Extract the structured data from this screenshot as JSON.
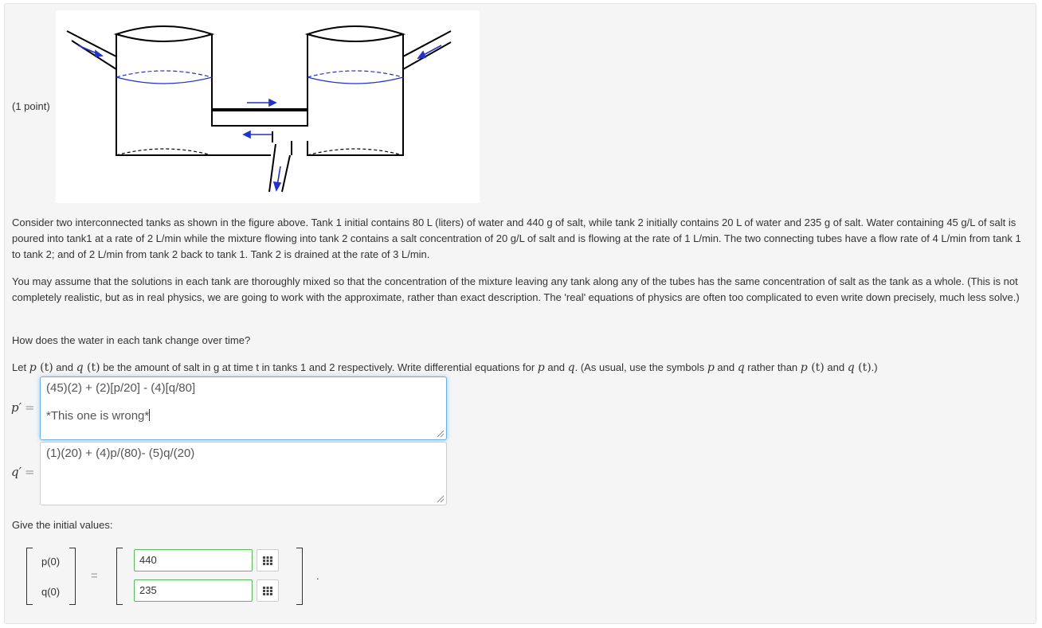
{
  "problem": {
    "points": "(1 point)",
    "paragraph1": "Consider two interconnected tanks as shown in the figure above. Tank 1 initial contains 80 L (liters) of water and 440 g of salt, while tank 2 initially contains 20 L of water and 235 g of salt. Water containing 45 g/L of salt is poured into tank1 at a rate of 2 L/min while the mixture flowing into tank 2 contains a salt concentration of 20 g/L of salt and is flowing at the rate of 1 L/min. The two connecting tubes have a flow rate of 4 L/min from tank 1 to tank 2; and of 2 L/min from tank 2 back to tank 1. Tank 2 is drained at the rate of 3 L/min.",
    "paragraph2": "You may assume that the solutions in each tank are thoroughly mixed so that the concentration of the mixture leaving any tank along any of the tubes has the same concentration of salt as the tank as a whole. (This is not completely realistic, but as in real physics, we are going to work with the approximate, rather than exact description. The 'real' equations of physics are often too complicated to even write down precisely, much less solve.)",
    "question": "How does the water in each tank change over time?",
    "let_parts": {
      "t1": "Let ",
      "pt": "p",
      "paren_t": "(t)",
      "t2": " and ",
      "qt": "q",
      "t3": " be the amount of salt in g at time t in tanks 1 and 2 respectively. Write differential equations for ",
      "p": "p",
      "and": " and ",
      "q": "q",
      "t4": ". (As usual, use the symbols ",
      "t5": " rather than ",
      "t6": ".)"
    },
    "initial_prompt": "Give the initial values:"
  },
  "answers": {
    "p_label": "p′",
    "q_label": "q′",
    "eq": "=",
    "p_line1": "(45)(2) + (2)[p/20] - (4)[q/80]",
    "p_line2": "*This one is wrong*",
    "q_line1": "(1)(20) + (4)p/(80)- (5)q/(20)"
  },
  "initial": {
    "p_label": "p(0)",
    "q_label": "q(0)",
    "p_value": "440",
    "q_value": "235",
    "equals": "=",
    "end": "."
  },
  "colors": {
    "accent_blue": "#66afe9",
    "valid_green": "#5cb85c",
    "arrow_blue": "#2233cc"
  }
}
